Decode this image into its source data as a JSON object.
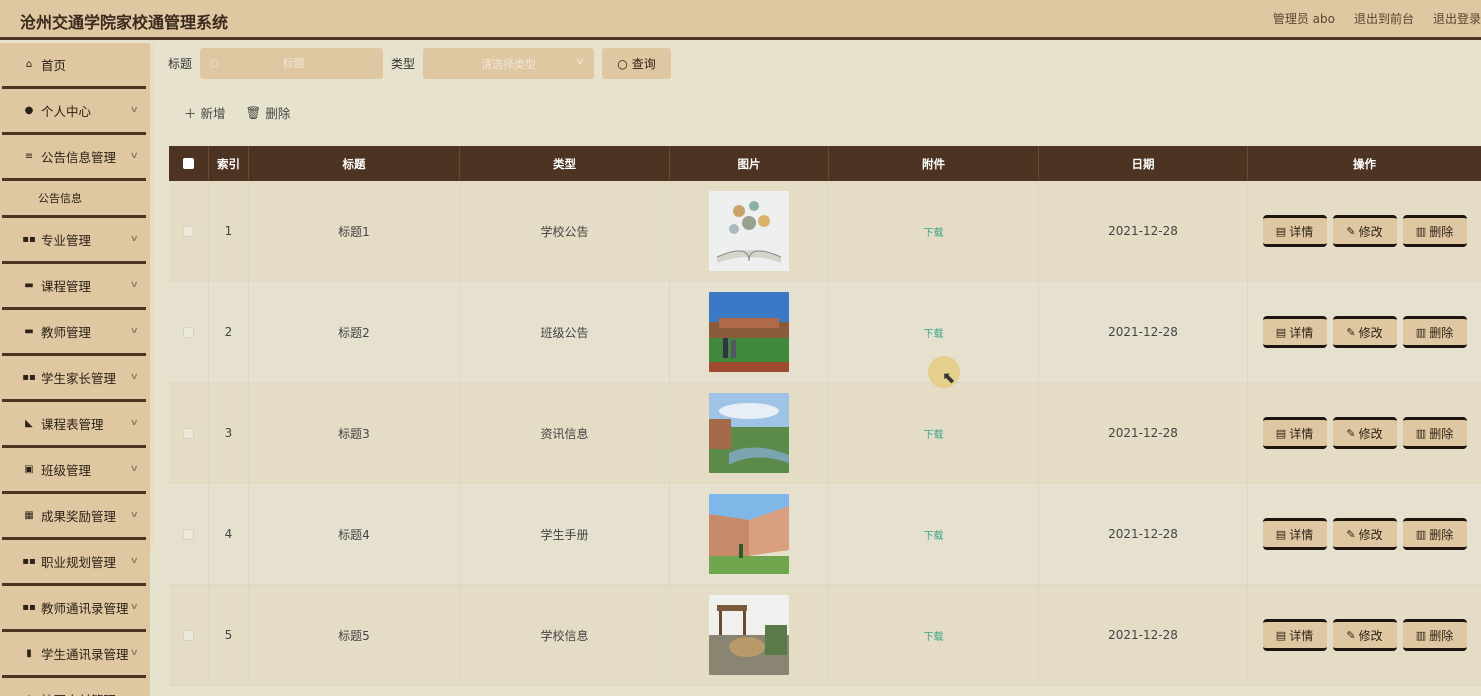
{
  "header": {
    "title": "沧州交通学院家校通管理系统",
    "admin": "管理员 abo",
    "front": "退出到前台",
    "logout": "退出登录"
  },
  "sidebar": {
    "items": [
      {
        "label": "首页",
        "icon": "home-icon",
        "glyph": "⌂",
        "chevron": false
      },
      {
        "label": "个人中心",
        "icon": "user-icon",
        "glyph": "●",
        "chevron": true
      },
      {
        "label": "公告信息管理",
        "icon": "list-icon",
        "glyph": "≡",
        "chevron": true
      },
      {
        "label": "专业管理",
        "icon": "grid-icon",
        "glyph": "▪▪",
        "chevron": true
      },
      {
        "label": "课程管理",
        "icon": "monitor-icon",
        "glyph": "▬",
        "chevron": true
      },
      {
        "label": "教师管理",
        "icon": "monitor-icon",
        "glyph": "▬",
        "chevron": true
      },
      {
        "label": "学生家长管理",
        "icon": "grid-icon",
        "glyph": "▪▪",
        "chevron": true
      },
      {
        "label": "课程表管理",
        "icon": "thumb-icon",
        "glyph": "◣",
        "chevron": true
      },
      {
        "label": "班级管理",
        "icon": "box-icon",
        "glyph": "▣",
        "chevron": true
      },
      {
        "label": "成果奖励管理",
        "icon": "grid-icon",
        "glyph": "▦",
        "chevron": true
      },
      {
        "label": "职业规划管理",
        "icon": "grid-icon",
        "glyph": "▪▪",
        "chevron": true
      },
      {
        "label": "教师通讯录管理",
        "icon": "grid-icon",
        "glyph": "▪▪",
        "chevron": true
      },
      {
        "label": "学生通讯录管理",
        "icon": "chart-icon",
        "glyph": "▮",
        "chevron": true
      },
      {
        "label": "校园支付管理",
        "icon": "pay-icon",
        "glyph": "●",
        "chevron": true
      }
    ],
    "submenu": "公告信息"
  },
  "search": {
    "title_label": "标题",
    "title_placeholder": "标题",
    "type_label": "类型",
    "type_placeholder": "请选择类型",
    "query": "查询"
  },
  "actions": {
    "add": "新增",
    "delete": "删除"
  },
  "table": {
    "headers": [
      "索引",
      "标题",
      "类型",
      "图片",
      "附件",
      "日期",
      "操作"
    ],
    "rows": [
      {
        "index": "1",
        "title": "标题1",
        "type": "学校公告",
        "attachment": "下载",
        "date": "2021-12-28"
      },
      {
        "index": "2",
        "title": "标题2",
        "type": "班级公告",
        "attachment": "下载",
        "date": "2021-12-28"
      },
      {
        "index": "3",
        "title": "标题3",
        "type": "资讯信息",
        "attachment": "下载",
        "date": "2021-12-28"
      },
      {
        "index": "4",
        "title": "标题4",
        "type": "学生手册",
        "attachment": "下载",
        "date": "2021-12-28"
      },
      {
        "index": "5",
        "title": "标题5",
        "type": "学校信息",
        "attachment": "下载",
        "date": "2021-12-28"
      }
    ],
    "op_detail": "详情",
    "op_edit": "修改",
    "op_delete": "删除"
  },
  "colors": {
    "header_bg": "#dfc7a1",
    "dark_brown": "#4d3322",
    "download_link": "#3aa38a"
  }
}
